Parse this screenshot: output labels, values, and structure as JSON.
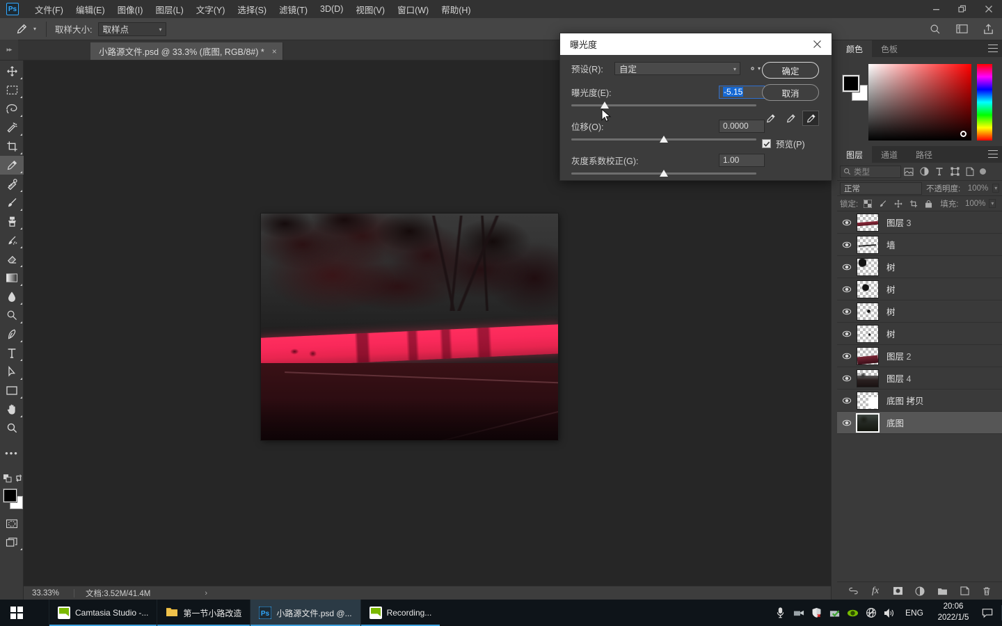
{
  "app": {
    "logo": "Ps",
    "window_controls": {
      "minimize": "minimize-icon",
      "restore": "restore-icon",
      "close": "close-icon"
    }
  },
  "menubar": {
    "items": [
      {
        "label": "文件(F)",
        "name": "menu-file"
      },
      {
        "label": "编辑(E)",
        "name": "menu-edit"
      },
      {
        "label": "图像(I)",
        "name": "menu-image"
      },
      {
        "label": "图层(L)",
        "name": "menu-layer"
      },
      {
        "label": "文字(Y)",
        "name": "menu-type"
      },
      {
        "label": "选择(S)",
        "name": "menu-select"
      },
      {
        "label": "滤镜(T)",
        "name": "menu-filter"
      },
      {
        "label": "3D(D)",
        "name": "menu-3d"
      },
      {
        "label": "视图(V)",
        "name": "menu-view"
      },
      {
        "label": "窗口(W)",
        "name": "menu-window"
      },
      {
        "label": "帮助(H)",
        "name": "menu-help"
      }
    ]
  },
  "options_bar": {
    "tool_icon": "eyedropper-icon",
    "sample_size_label": "取样大小:",
    "sample_size_value": "取样点",
    "right_icons": [
      "search-icon",
      "workspace-icon",
      "share-icon"
    ]
  },
  "document_tab": {
    "title": "小路源文件.psd @ 33.3% (底图, RGB/8#) *",
    "close": "×"
  },
  "tools": [
    {
      "name": "move-tool",
      "icon": "move-icon",
      "has_corner": true
    },
    {
      "name": "rectangular-select-tool",
      "icon": "marquee-icon",
      "has_corner": true
    },
    {
      "name": "lasso-tool",
      "icon": "lasso-icon",
      "has_corner": true
    },
    {
      "name": "magic-wand-tool",
      "icon": "magic-wand-icon",
      "has_corner": true
    },
    {
      "name": "crop-tool",
      "icon": "crop-icon",
      "has_corner": true
    },
    {
      "name": "eyedropper-tool",
      "icon": "eyedropper-icon",
      "has_corner": true,
      "selected": true
    },
    {
      "name": "healing-brush-tool",
      "icon": "healing-brush-icon",
      "has_corner": true
    },
    {
      "name": "brush-tool",
      "icon": "brush-icon",
      "has_corner": true
    },
    {
      "name": "clone-stamp-tool",
      "icon": "stamp-icon",
      "has_corner": true
    },
    {
      "name": "history-brush-tool",
      "icon": "history-brush-icon",
      "has_corner": true
    },
    {
      "name": "eraser-tool",
      "icon": "eraser-icon",
      "has_corner": true
    },
    {
      "name": "gradient-tool",
      "icon": "gradient-icon",
      "has_corner": true
    },
    {
      "name": "blur-tool",
      "icon": "blur-drop-icon",
      "has_corner": true
    },
    {
      "name": "dodge-tool",
      "icon": "dodge-icon",
      "has_corner": true
    },
    {
      "name": "pen-tool",
      "icon": "pen-icon",
      "has_corner": true
    },
    {
      "name": "type-tool",
      "icon": "type-t-icon",
      "has_corner": true
    },
    {
      "name": "path-selection-tool",
      "icon": "arrow-cursor-icon",
      "has_corner": true
    },
    {
      "name": "shape-tool",
      "icon": "rectangle-shape-icon",
      "has_corner": true
    },
    {
      "name": "hand-tool",
      "icon": "hand-icon",
      "has_corner": true
    },
    {
      "name": "zoom-tool",
      "icon": "magnifier-icon",
      "has_corner": false
    },
    {
      "name": "more-tools",
      "icon": "ellipsis-icon",
      "has_corner": false
    }
  ],
  "tool_extras": {
    "default_colors": "default-colors-icon",
    "swap_colors": "swap-colors-icon",
    "foreground_color": "#000000",
    "background_color": "#ffffff",
    "quick_mask": "quick-mask-icon",
    "screen_mode": "screen-mode-icon"
  },
  "status_bar": {
    "zoom": "33.33%",
    "doc_info": "文档:3.52M/41.4M",
    "arrow": "›"
  },
  "color_panel": {
    "tabs": [
      {
        "label": "颜色",
        "name": "tab-color",
        "active": true
      },
      {
        "label": "色板",
        "name": "tab-swatches",
        "active": false
      }
    ],
    "menu_icon": "panel-menu-icon",
    "foreground": "#000000",
    "background": "#ffffff",
    "field_base_hue": "#ff0000"
  },
  "layers_panel": {
    "tabs": [
      {
        "label": "图层",
        "name": "tab-layers",
        "active": true
      },
      {
        "label": "通道",
        "name": "tab-channels",
        "active": false
      },
      {
        "label": "路径",
        "name": "tab-paths",
        "active": false
      }
    ],
    "menu_icon": "panel-menu-icon",
    "filter": {
      "search_icon": "search-icon",
      "search_placeholder": "类型",
      "icons": [
        "image-filter-icon",
        "adjustment-filter-icon",
        "type-filter-icon",
        "shape-filter-icon",
        "smart-object-filter-icon"
      ],
      "toggle": "filter-toggle-icon"
    },
    "blend_mode": "正常",
    "opacity_label": "不透明度:",
    "opacity_value": "100%",
    "lock_label": "锁定:",
    "lock_icons": [
      "lock-transparency-icon",
      "lock-image-icon",
      "lock-position-icon",
      "lock-artboard-icon",
      "lock-all-icon"
    ],
    "fill_label": "填充:",
    "fill_value": "100%",
    "layers": [
      {
        "name": "图层",
        "num": "3",
        "visible": true,
        "selected": false,
        "thumb": "wall-strip"
      },
      {
        "name": "墙",
        "num": "",
        "visible": true,
        "selected": false,
        "thumb": "line-strip"
      },
      {
        "name": "树",
        "num": "",
        "visible": true,
        "selected": false,
        "thumb": "tree-left"
      },
      {
        "name": "树",
        "num": "",
        "visible": true,
        "selected": false,
        "thumb": "tree-blob"
      },
      {
        "name": "树",
        "num": "",
        "visible": true,
        "selected": false,
        "thumb": "tree-small"
      },
      {
        "name": "树",
        "num": "",
        "visible": true,
        "selected": false,
        "thumb": "tree-tiny"
      },
      {
        "name": "图层",
        "num": "2",
        "visible": true,
        "selected": false,
        "thumb": "wall-dark"
      },
      {
        "name": "图层",
        "num": "4",
        "visible": true,
        "selected": false,
        "thumb": "scene-strip"
      },
      {
        "name": "底图 拷贝",
        "num": "",
        "visible": true,
        "selected": false,
        "thumb": "empty-curve"
      },
      {
        "name": "底图",
        "num": "",
        "visible": true,
        "selected": true,
        "thumb": "photo-dark"
      }
    ],
    "bottom_icons": [
      "link-layers-icon",
      "layer-fx-icon",
      "add-mask-icon",
      "new-adjustment-icon",
      "new-group-icon",
      "new-layer-icon",
      "delete-layer-icon"
    ]
  },
  "dialog": {
    "title": "曝光度",
    "close": "close-icon",
    "preset_label": "预设(R):",
    "preset_value": "自定",
    "gear_icon": "gear-icon",
    "ok_label": "确定",
    "cancel_label": "取消",
    "fields": [
      {
        "label": "曝光度(E):",
        "value": "-5.15",
        "name": "exposure",
        "focused": true,
        "slider_pct": 18
      },
      {
        "label": "位移(O):",
        "value": "0.0000",
        "name": "offset",
        "focused": false,
        "slider_pct": 50
      },
      {
        "label": "灰度系数校正(G):",
        "value": "1.00",
        "name": "gamma",
        "focused": false,
        "slider_pct": 50
      }
    ],
    "eyedroppers": [
      {
        "name": "set-black-point-eyedropper",
        "active": false
      },
      {
        "name": "set-gray-point-eyedropper",
        "active": false
      },
      {
        "name": "set-white-point-eyedropper",
        "active": true
      }
    ],
    "preview_label": "预览(P)",
    "preview_checked": true,
    "accent_color": "#1669d4"
  },
  "taskbar": {
    "start_icon": "windows-start-icon",
    "items": [
      {
        "label": "Camtasia Studio -...",
        "icon": "camtasia-icon",
        "active": false,
        "name": "taskbar-camtasia-studio"
      },
      {
        "label": "第一节小路改造",
        "icon": "folder-icon",
        "active": false,
        "name": "taskbar-folder"
      },
      {
        "label": "小路源文件.psd @...",
        "icon": "photoshop-icon",
        "active": true,
        "name": "taskbar-photoshop"
      },
      {
        "label": "Recording...",
        "icon": "camtasia-icon",
        "active": false,
        "name": "taskbar-recording"
      }
    ],
    "tray_icons": [
      "microphone-icon",
      "camtasia-tray-icon",
      "security-shield-icon",
      "green-check-icon",
      "nvidia-eye-icon",
      "network-offline-icon",
      "volume-icon"
    ],
    "language": "ENG",
    "time": "20:06",
    "date": "2022/1/5",
    "notification_icon": "notification-icon"
  }
}
